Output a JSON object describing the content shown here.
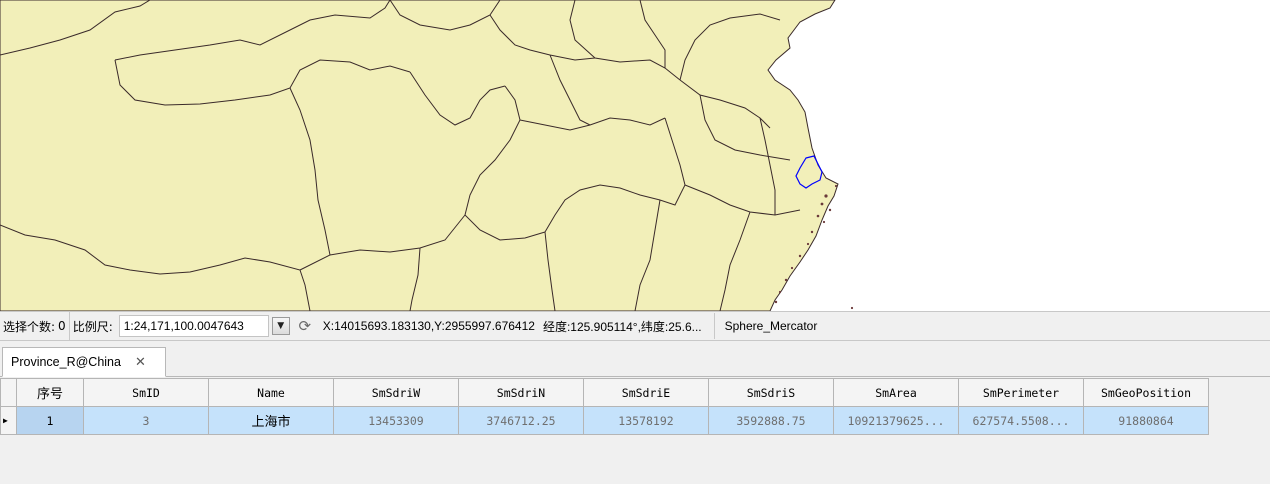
{
  "status": {
    "selected_label": "选择个数:",
    "selected_count": "0",
    "scale_label": "比例尺:",
    "scale_value": "1:24,171,100.0047643",
    "coordinates": "X:14015693.183130,Y:2955997.676412",
    "lonlat": "经度:125.905114°,纬度:25.6...",
    "projection": "Sphere_Mercator"
  },
  "tab": {
    "label": "Province_R@China",
    "close": "✕"
  },
  "table": {
    "headers": [
      "序号",
      "SmID",
      "Name",
      "SmSdriW",
      "SmSdriN",
      "SmSdriE",
      "SmSdriS",
      "SmArea",
      "SmPerimeter",
      "SmGeoPosition"
    ],
    "rows": [
      [
        "1",
        "3",
        "上海市",
        "13453309",
        "3746712.25",
        "13578192",
        "3592888.75",
        "10921379625...",
        "627574.5508...",
        "91880864"
      ]
    ]
  },
  "map": {
    "land_color": "#f2efb9",
    "border_color": "#3a2a2a",
    "highlight_color": "#0000ff",
    "coast_color": "#6b3a3a"
  },
  "icons": {
    "dropdown": "chevron-down-icon",
    "refresh": "refresh-icon",
    "row_indicator": "row-pointer-icon"
  }
}
